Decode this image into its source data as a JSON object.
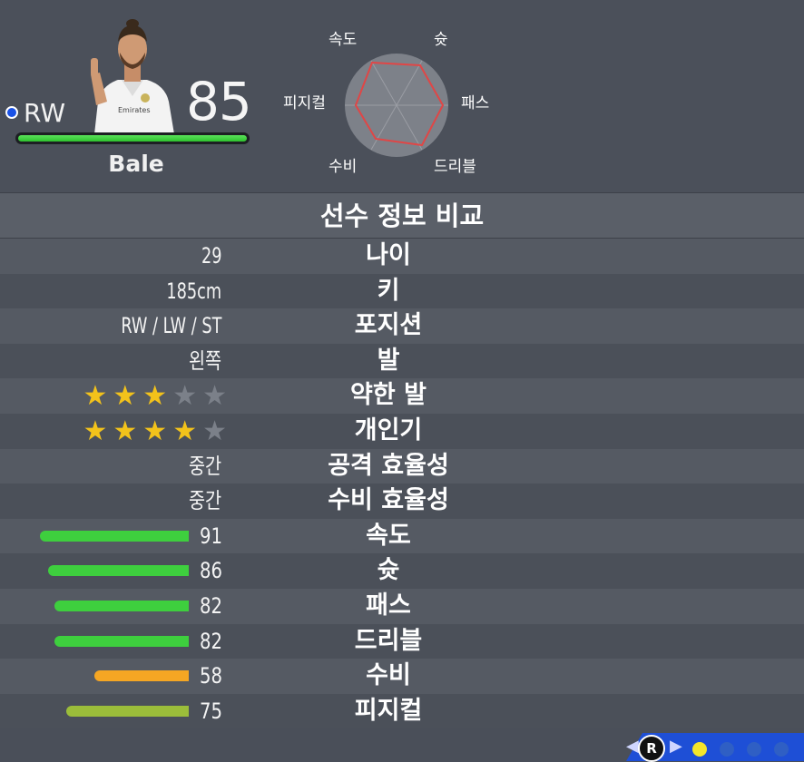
{
  "player": {
    "position": "RW",
    "overall": "85",
    "name": "Bale",
    "position_dot_color": "#1a52e6"
  },
  "radar": {
    "labels": {
      "pace": "속도",
      "shooting": "슛",
      "passing": "패스",
      "dribbling": "드리블",
      "defending": "수비",
      "physical": "피지컬"
    }
  },
  "section_title": "선수 정보 비교",
  "info_rows": [
    {
      "label": "나이",
      "value": "29"
    },
    {
      "label": "키",
      "value": "185cm"
    },
    {
      "label": "포지션",
      "value": "RW / LW / ST"
    },
    {
      "label": "발",
      "value": "왼쪽"
    }
  ],
  "star_rows": [
    {
      "label": "약한 발",
      "rating": 3,
      "max": 5
    },
    {
      "label": "개인기",
      "rating": 4,
      "max": 5
    }
  ],
  "workrate_rows": [
    {
      "label": "공격 효율성",
      "value": "중간"
    },
    {
      "label": "수비 효율성",
      "value": "중간"
    }
  ],
  "stat_rows": [
    {
      "label": "속도",
      "value": "91",
      "color": "#3ecf3e"
    },
    {
      "label": "슛",
      "value": "86",
      "color": "#3ecf3e"
    },
    {
      "label": "패스",
      "value": "82",
      "color": "#3ecf3e"
    },
    {
      "label": "드리블",
      "value": "82",
      "color": "#3ecf3e"
    },
    {
      "label": "수비",
      "value": "58",
      "color": "#f5a623"
    },
    {
      "label": "피지컬",
      "value": "75",
      "color": "#9bbd3a"
    }
  ],
  "footer": {
    "button_label": "R",
    "pages": 4,
    "active_page": 1
  },
  "colors": {
    "star_on": "#f2c21b",
    "star_off": "#7b8089",
    "radar_outline": "#e04646"
  }
}
